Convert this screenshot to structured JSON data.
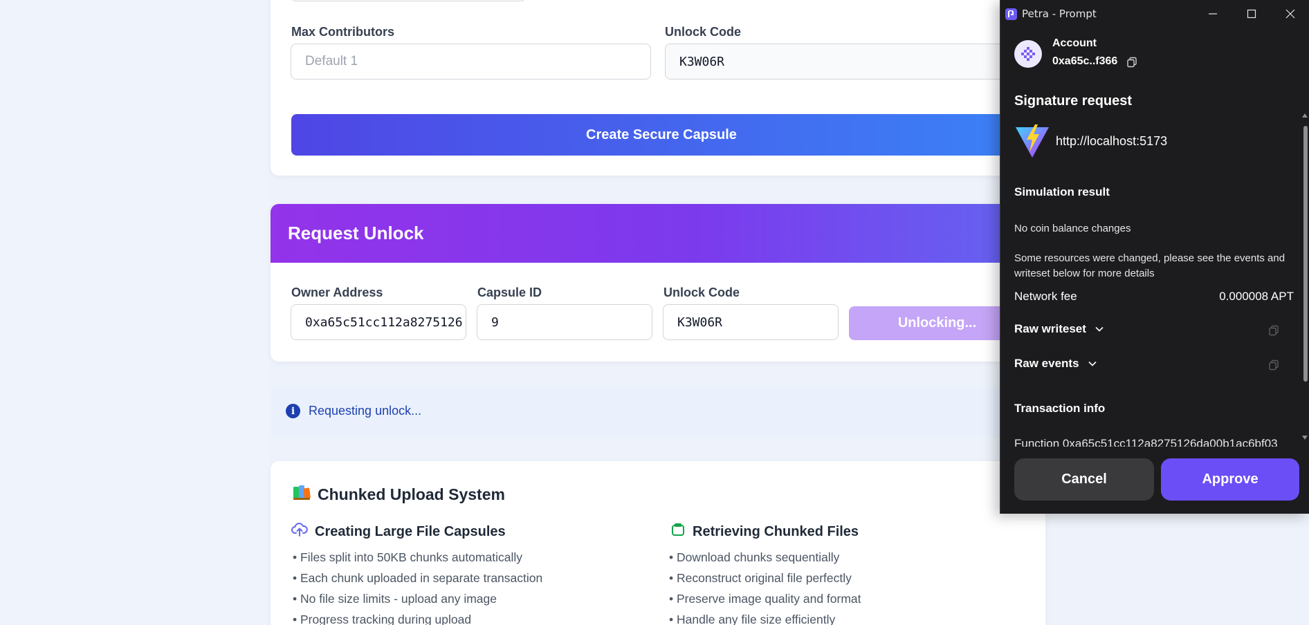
{
  "create_form": {
    "max_contributors_label": "Max Contributors",
    "max_contributors_placeholder": "Default 1",
    "unlock_code_label": "Unlock Code",
    "unlock_code_value": "K3W06R",
    "create_button": "Create Secure Capsule"
  },
  "request_unlock": {
    "title": "Request Unlock",
    "owner_address_label": "Owner Address",
    "owner_address_value": "0xa65c51cc112a8275126",
    "capsule_id_label": "Capsule ID",
    "capsule_id_value": "9",
    "unlock_code_label": "Unlock Code",
    "unlock_code_value": "K3W06R",
    "submit_button": "Unlocking..."
  },
  "status": {
    "message": "Requesting unlock..."
  },
  "chunked": {
    "title": "Chunked Upload System",
    "left": {
      "title": "Creating Large File Capsules",
      "items": [
        "Files split into 50KB chunks automatically",
        "Each chunk uploaded in separate transaction",
        "No file size limits - upload any image",
        "Progress tracking during upload"
      ]
    },
    "right": {
      "title": "Retrieving Chunked Files",
      "items": [
        "Download chunks sequentially",
        "Reconstruct original file perfectly",
        "Preserve image quality and format",
        "Handle any file size efficiently"
      ]
    }
  },
  "petra": {
    "window_title": "Petra - Prompt",
    "account_label": "Account",
    "account_address": "0xa65c..f366",
    "heading": "Signature request",
    "origin": "http://localhost:5173",
    "simulation_title": "Simulation result",
    "no_balance_changes": "No coin balance changes",
    "resources_note_line1": "Some resources were changed, please see the events and",
    "resources_note_line2": "writeset below for more details",
    "network_fee_label": "Network fee",
    "network_fee_value": "0.000008 APT",
    "raw_writeset": "Raw writeset",
    "raw_events": "Raw events",
    "transaction_info": "Transaction info",
    "function_partial": "Function  0xa65c51cc112a8275126da00b1ac6bf03",
    "cancel": "Cancel",
    "approve": "Approve",
    "accent_color": "#6b4ef6"
  }
}
